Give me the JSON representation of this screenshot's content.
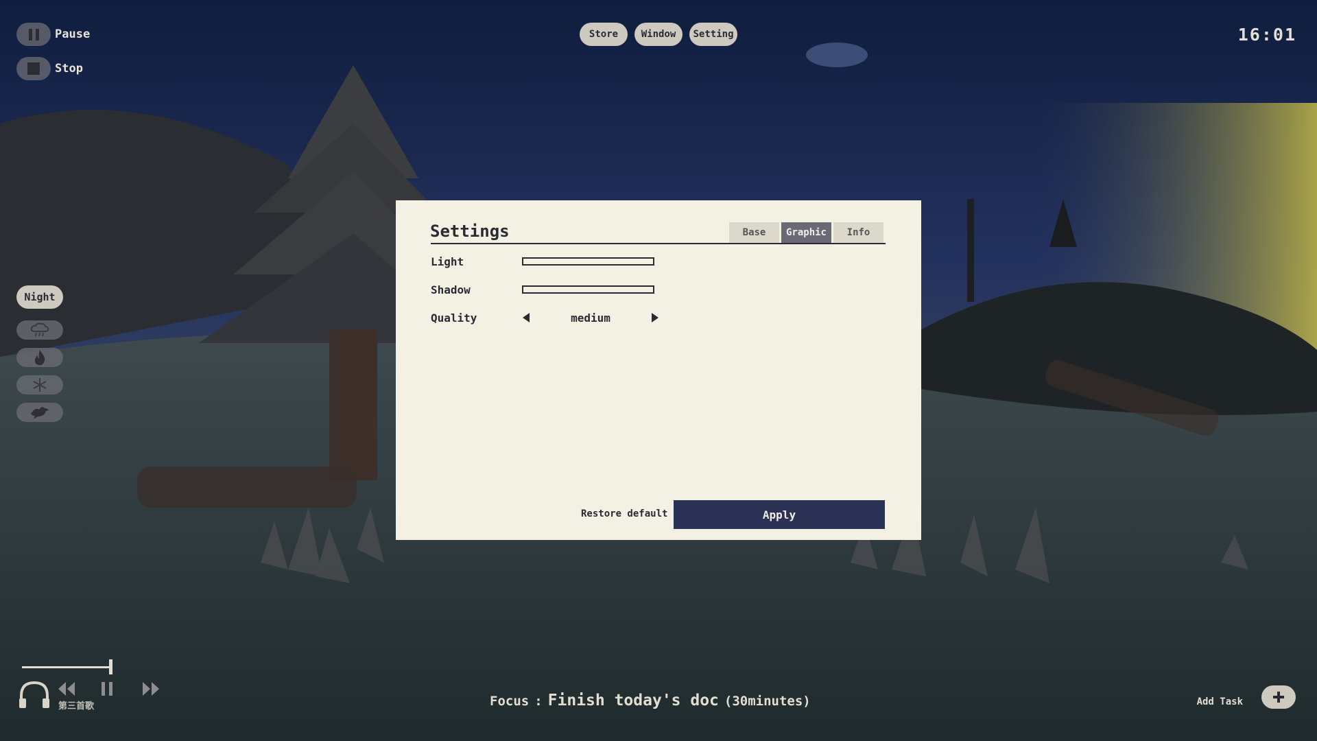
{
  "top_controls": {
    "pause_label": "Pause",
    "stop_label": "Stop"
  },
  "nav": [
    "Store",
    "Window",
    "Setting"
  ],
  "clock": "16:01",
  "ambience": {
    "night_label": "Night",
    "icons": [
      "rain-cloud-icon",
      "fire-icon",
      "snowflake-icon",
      "bird-icon"
    ]
  },
  "settings": {
    "title": "Settings",
    "tabs": [
      {
        "label": "Base",
        "active": false
      },
      {
        "label": "Graphic",
        "active": true
      },
      {
        "label": "Info",
        "active": false
      }
    ],
    "rows": {
      "light_label": "Light",
      "shadow_label": "Shadow",
      "quality_label": "Quality",
      "quality_value": "medium"
    },
    "restore_label": "Restore default",
    "apply_label": "Apply"
  },
  "player": {
    "song": "第三首歌"
  },
  "focus": {
    "label": "Focus",
    "separator": ":",
    "task": "Finish today's doc",
    "duration": "(30minutes)"
  },
  "add_task_label": "Add Task",
  "colors": {
    "dialog_bg": "#f3f1e4",
    "apply_bg": "#2c3256",
    "active_tab": "#6a6a76"
  }
}
